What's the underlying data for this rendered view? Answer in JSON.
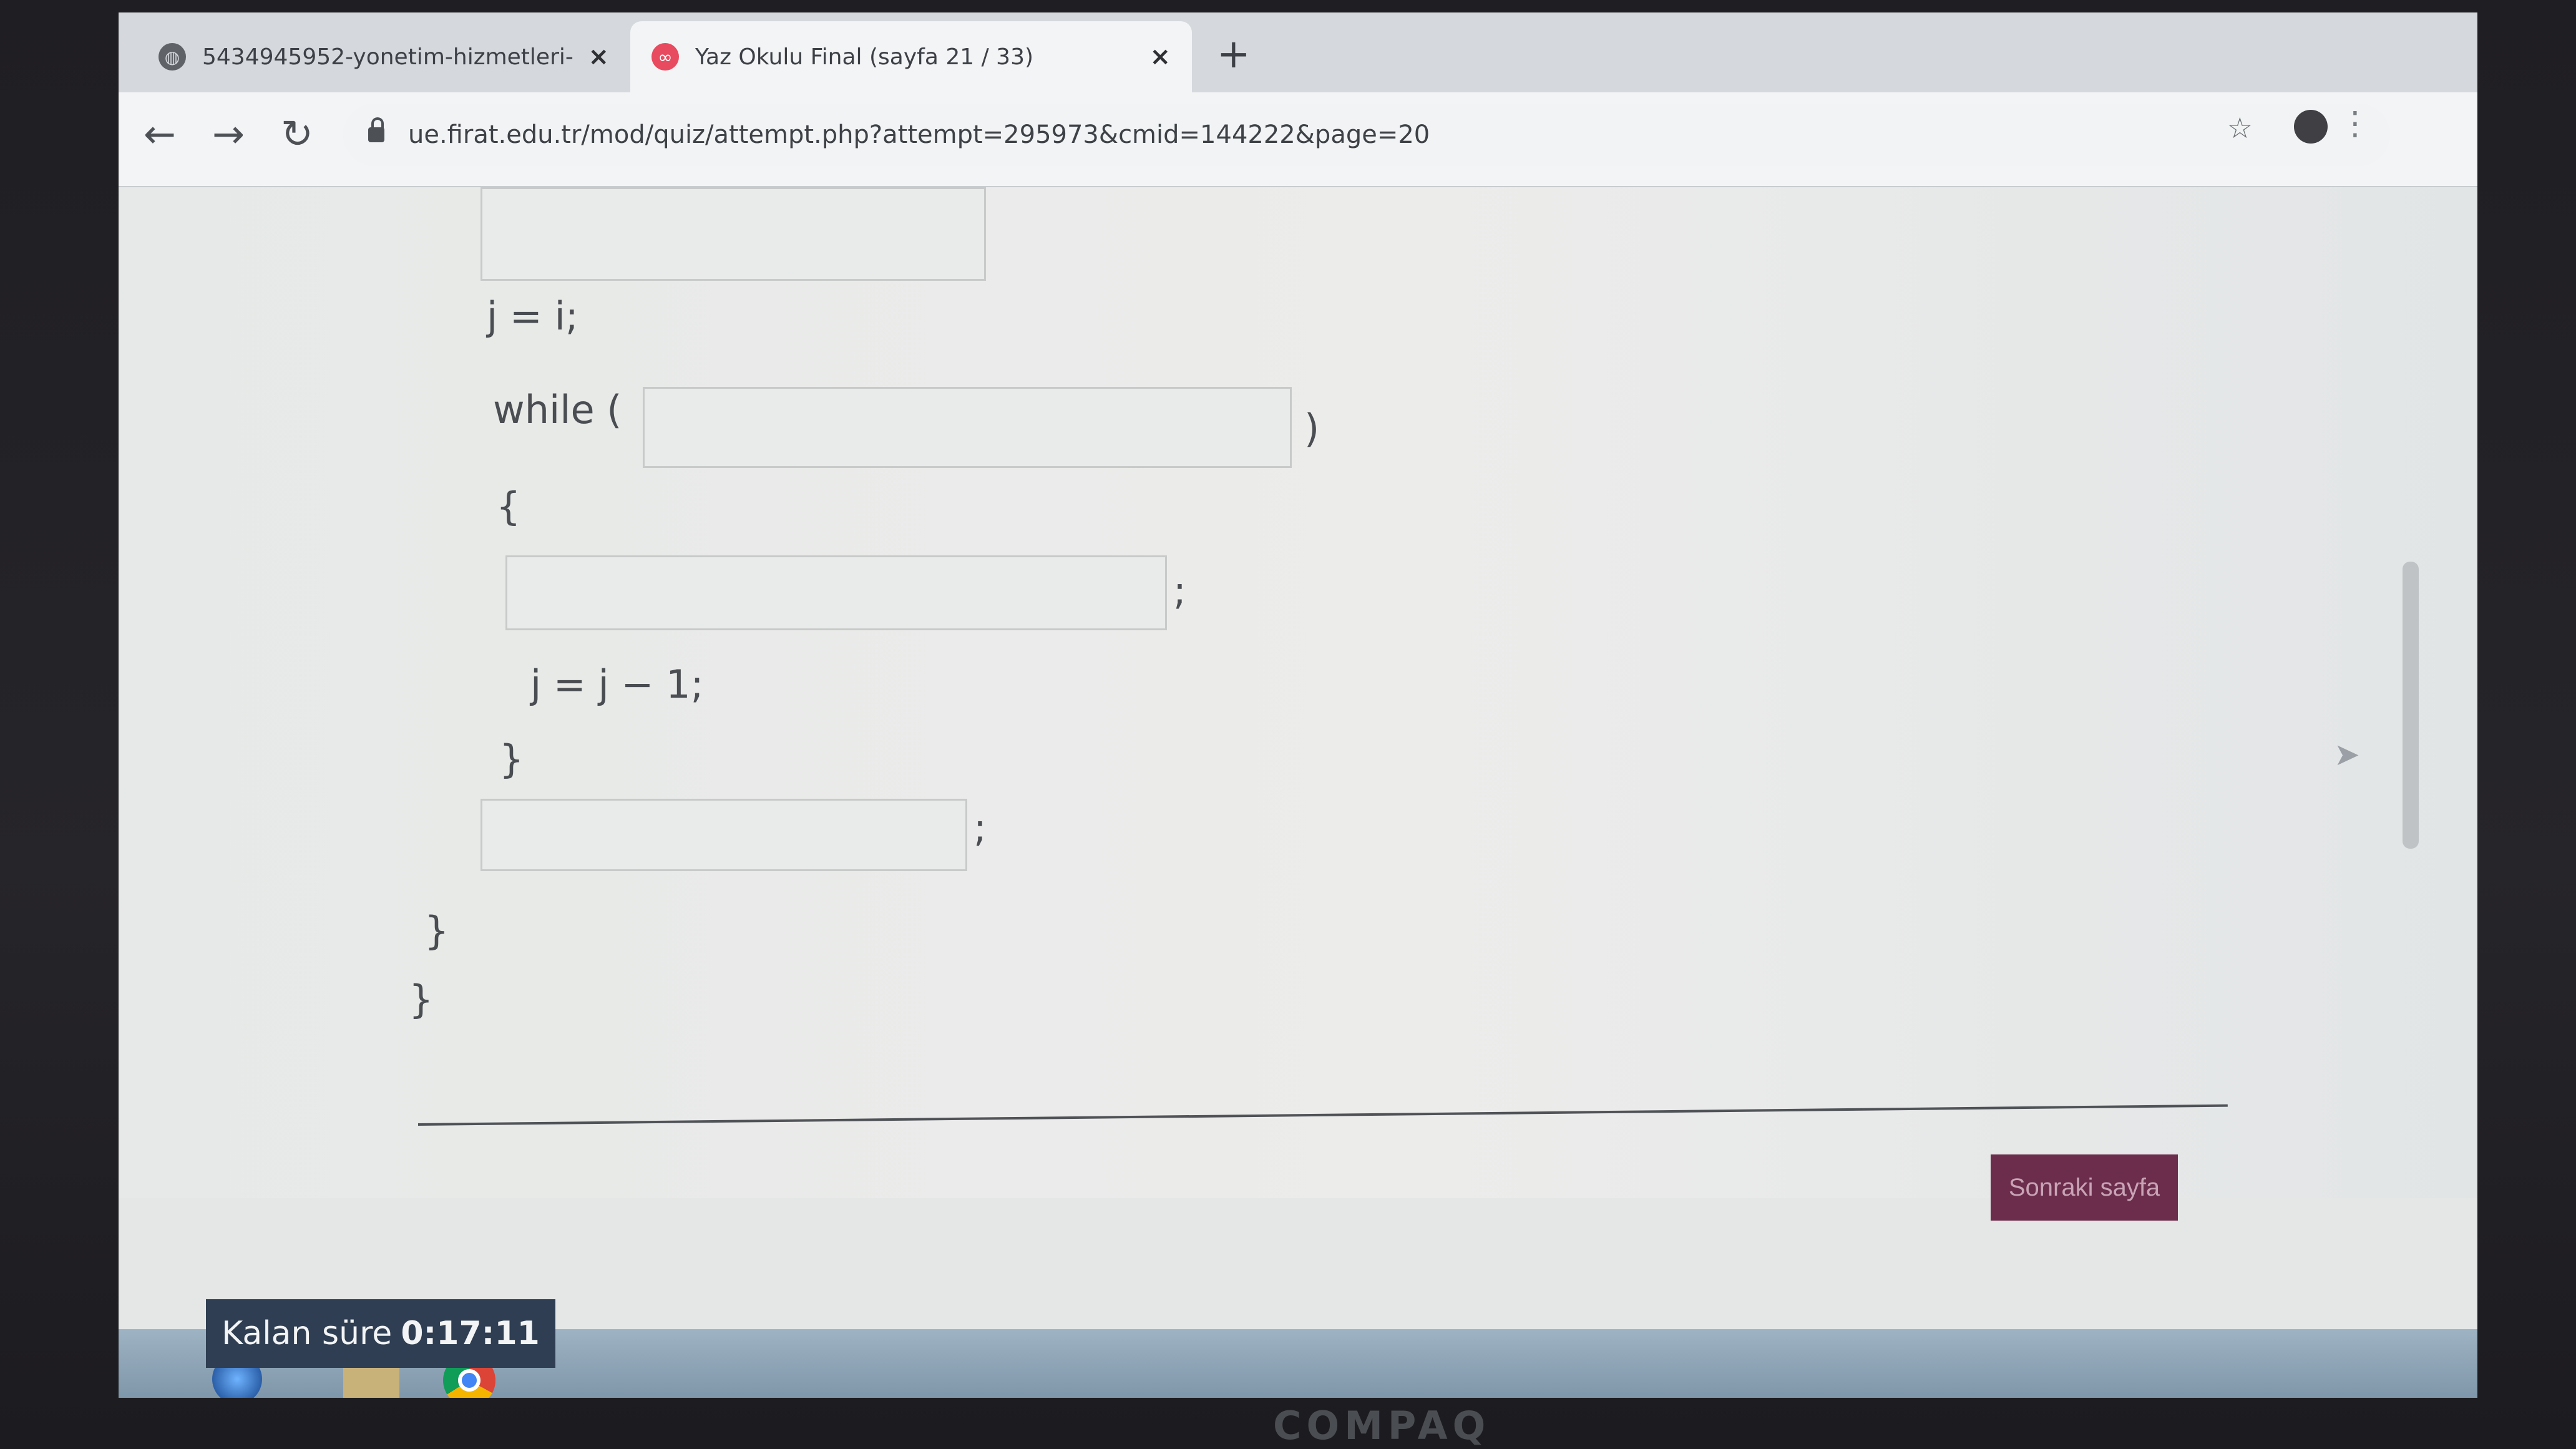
{
  "browser": {
    "tabs": [
      {
        "title": "5434945952-yonetim-hizmetleri-",
        "active": false,
        "icon": "globe-icon"
      },
      {
        "title": "Yaz Okulu Final (sayfa 21 / 33)",
        "active": true,
        "icon": "moodle-icon"
      }
    ],
    "new_tab_label": "+",
    "close_glyph": "×",
    "url": "ue.firat.edu.tr/mod/quiz/attempt.php?attempt=295973&cmid=144222&page=20"
  },
  "quiz": {
    "code_lines": {
      "j_assign": "j = i;",
      "while_open": "while (",
      "while_close": ")",
      "brace_open": "{",
      "semicolon_1": ";",
      "decrement": "j = j − 1;",
      "brace_close": "}",
      "semicolon_2": ";",
      "outer_close_1": "}",
      "outer_close_2": "}"
    },
    "inputs": [
      "",
      "",
      "",
      ""
    ],
    "next_button": "Sonraki sayfa"
  },
  "timer": {
    "label": "Kalan süre",
    "value": "0:17:11"
  },
  "monitor": {
    "brand": "COMPAQ"
  },
  "colors": {
    "next_button": "#6b2d4b",
    "timer_bg": "#2f3e52",
    "active_tab": "#f3f4f5"
  }
}
